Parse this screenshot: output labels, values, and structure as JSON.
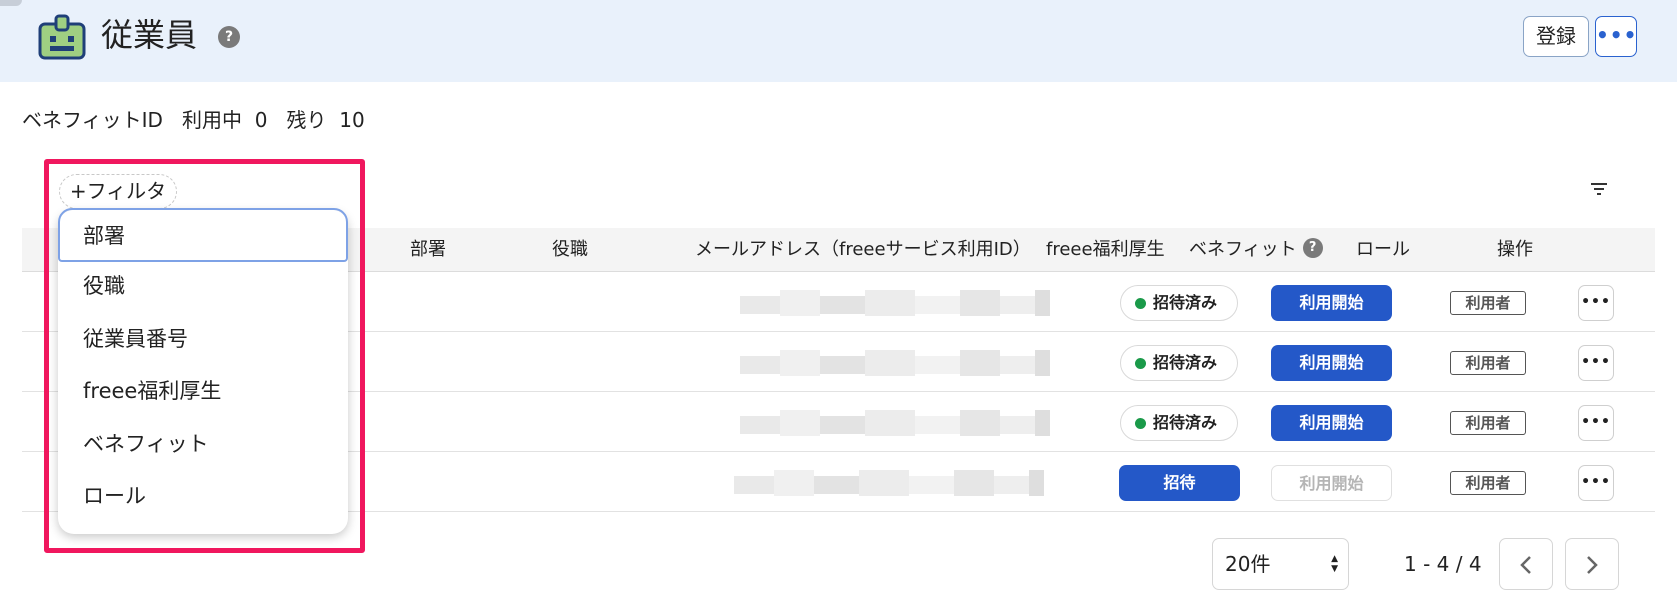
{
  "header": {
    "title": "従業員",
    "help_glyph": "?",
    "register_label": "登録",
    "more_label": "•••",
    "app_icon": "id-badge-icon"
  },
  "benefit": {
    "label": "ベネフィットID",
    "in_use_label": "利用中",
    "in_use_value": "0",
    "remaining_label": "残り",
    "remaining_value": "10"
  },
  "filter": {
    "chip_label": "+フィルタ",
    "menu_items": [
      "部署",
      "役職",
      "従業員番号",
      "freee福利厚生",
      "ベネフィット",
      "ロール"
    ]
  },
  "table": {
    "columns": {
      "department": "部署",
      "position": "役職",
      "email": "メールアドレス（freeeサービス利用ID）",
      "freee_welfare": "freee福利厚生",
      "benefit": "ベネフィット",
      "role": "ロール",
      "actions": "操作"
    },
    "rows": [
      {
        "email": "",
        "welfare_status": "招待済み",
        "welfare_type": "invited",
        "benefit_label": "利用開始",
        "benefit_enabled": true,
        "role": "利用者",
        "more": "•••"
      },
      {
        "email": "",
        "welfare_status": "招待済み",
        "welfare_type": "invited",
        "benefit_label": "利用開始",
        "benefit_enabled": true,
        "role": "利用者",
        "more": "•••"
      },
      {
        "email": "",
        "welfare_status": "招待済み",
        "welfare_type": "invited",
        "benefit_label": "利用開始",
        "benefit_enabled": true,
        "role": "利用者",
        "more": "•••"
      },
      {
        "email": "",
        "welfare_status": "招待",
        "welfare_type": "invite-button",
        "benefit_label": "利用開始",
        "benefit_enabled": false,
        "role": "利用者",
        "more": "•••"
      }
    ]
  },
  "pagination": {
    "per_page": "20件",
    "range": "1 - 4 / 4",
    "prev_icon": "chevron-left-icon",
    "next_icon": "chevron-right-icon"
  },
  "colors": {
    "header_bg": "#e9f1fb",
    "primary": "#2458c8",
    "highlight": "#f0175e",
    "status_green": "#1a9a49"
  }
}
